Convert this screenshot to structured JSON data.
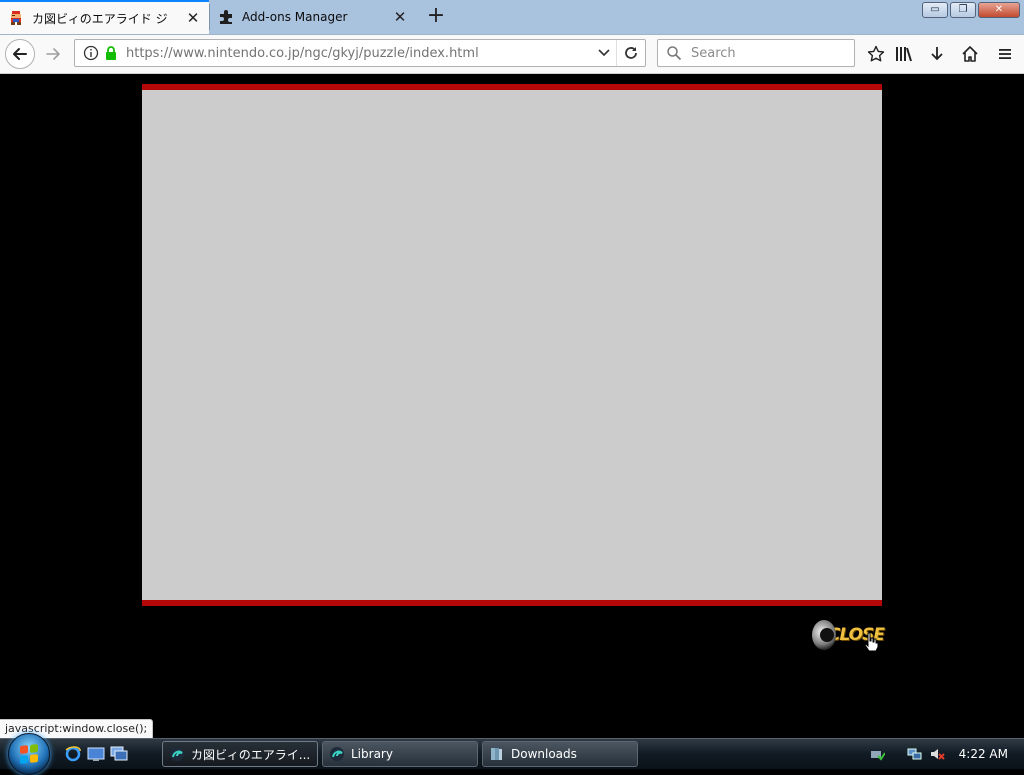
{
  "tabs": [
    {
      "title": "カ図ビィのエアライド ジ",
      "active": true,
      "favicon": "mario-favicon-icon"
    },
    {
      "title": "Add-ons Manager",
      "active": false,
      "favicon": "puzzle-piece-icon"
    }
  ],
  "window_controls": {
    "minimize": "▭",
    "restore": "❐",
    "close": "✕"
  },
  "navbar": {
    "url": "https://www.nintendo.co.jp/ngc/gkyj/puzzle/index.html",
    "search_placeholder": "Search"
  },
  "page": {
    "close_label": "CLOSE",
    "frame_color": "#cccccc",
    "border_color": "#b40808"
  },
  "status_text": "javascript:window.close();",
  "taskbar": {
    "buttons": [
      {
        "label": "カ図ビィのエアライ...",
        "active": true,
        "icon": "firefox-nightly-icon"
      },
      {
        "label": "Library",
        "active": false,
        "icon": "firefox-nightly-icon"
      },
      {
        "label": "Downloads",
        "active": false,
        "icon": "folder-icon"
      }
    ],
    "clock": "4:22 AM"
  }
}
